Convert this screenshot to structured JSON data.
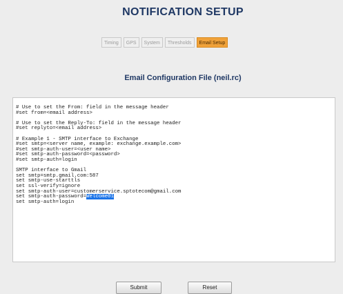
{
  "page": {
    "title": "NOTIFICATION SETUP"
  },
  "tabs": [
    {
      "label": "Timing"
    },
    {
      "label": "GPS"
    },
    {
      "label": "System"
    },
    {
      "label": "Thresholds"
    },
    {
      "label": "Email Setup",
      "active": true
    }
  ],
  "section": {
    "title": "Email Configuration File (neil.rc)"
  },
  "config": {
    "lines": [
      "# Use to set the From: field in the message header",
      "#set from=<email address>",
      "",
      "# Use to set the Reply-To: field in the message header",
      "#set replyto=<email address>",
      "",
      "# Example 1 - SMTP interface to Exchange",
      "#set smtp=<server name, example: exchange.example.com>",
      "#set smtp-auth-user=<user name>",
      "#set smtp-auth-password=<password>",
      "#set smtp-auth=login",
      "",
      "SMTP interface to Gmail",
      "set smtp=smtp.gmail.com:587",
      "set smtp-use-starttls",
      "set ssl-verify=ignore",
      "set smtp-auth-user=customerservice.sptotecom@gmail.com",
      "set smtp-auth-password=",
      "set smtp-auth=login"
    ],
    "password_value": "Welcome01"
  },
  "buttons": {
    "submit": "Submit",
    "reset": "Reset"
  },
  "colors": {
    "title": "#1f3864",
    "active_tab": "#f0a23a",
    "selection": "#1a73e8"
  }
}
